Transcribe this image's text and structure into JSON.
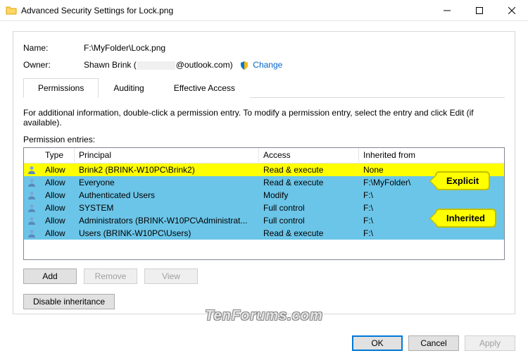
{
  "window": {
    "title": "Advanced Security Settings for Lock.png"
  },
  "header": {
    "name_label": "Name:",
    "name_value": "F:\\MyFolder\\Lock.png",
    "owner_label": "Owner:",
    "owner_value_prefix": "Shawn Brink",
    "owner_value_suffix": "@outlook.com)",
    "change_link": "Change"
  },
  "tabs": {
    "permissions": "Permissions",
    "auditing": "Auditing",
    "effective": "Effective Access"
  },
  "info_text": "For additional information, double-click a permission entry. To modify a permission entry, select the entry and click Edit (if available).",
  "list_label": "Permission entries:",
  "columns": {
    "type": "Type",
    "principal": "Principal",
    "access": "Access",
    "inherited": "Inherited from"
  },
  "rows": [
    {
      "type": "Allow",
      "principal": "Brink2 (BRINK-W10PC\\Brink2)",
      "access": "Read & execute",
      "inherited": "None",
      "hl": "yellow"
    },
    {
      "type": "Allow",
      "principal": "Everyone",
      "access": "Read & execute",
      "inherited": "F:\\MyFolder\\",
      "hl": "blue"
    },
    {
      "type": "Allow",
      "principal": "Authenticated Users",
      "access": "Modify",
      "inherited": "F:\\",
      "hl": "blue"
    },
    {
      "type": "Allow",
      "principal": "SYSTEM",
      "access": "Full control",
      "inherited": "F:\\",
      "hl": "blue"
    },
    {
      "type": "Allow",
      "principal": "Administrators (BRINK-W10PC\\Administrat...",
      "access": "Full control",
      "inherited": "F:\\",
      "hl": "blue"
    },
    {
      "type": "Allow",
      "principal": "Users (BRINK-W10PC\\Users)",
      "access": "Read & execute",
      "inherited": "F:\\",
      "hl": "blue"
    }
  ],
  "buttons": {
    "add": "Add",
    "remove": "Remove",
    "view": "View",
    "disable": "Disable inheritance",
    "ok": "OK",
    "cancel": "Cancel",
    "apply": "Apply"
  },
  "callouts": {
    "explicit": "Explicit",
    "inherited": "Inherited"
  },
  "watermark": "TenForums.com"
}
